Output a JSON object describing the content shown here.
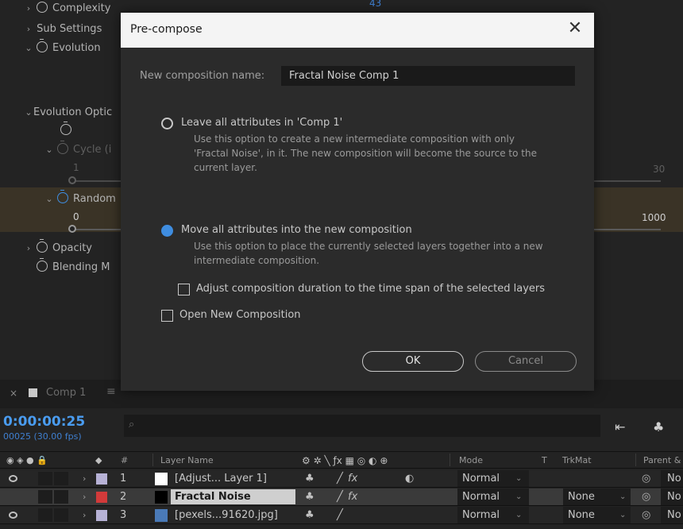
{
  "effect_controls": {
    "top_value": "43",
    "properties": [
      {
        "label": "Complexity",
        "twirl": "›"
      },
      {
        "label": "Sub Settings",
        "twirl": "›"
      },
      {
        "label": "Evolution",
        "twirl": "⌄"
      },
      {
        "label": "Evolution Optic",
        "twirl": "⌄"
      },
      {
        "label": "Cycle (i",
        "twirl": "⌄"
      },
      {
        "label": "Random",
        "twirl": "⌄"
      },
      {
        "label": "Opacity",
        "twirl": "›"
      },
      {
        "label": "Blending M",
        "twirl": ""
      }
    ],
    "cycle_min": "1",
    "cycle_max": "30",
    "random_min": "0",
    "random_max": "1000"
  },
  "dialog": {
    "title": "Pre-compose",
    "close_glyph": "✕",
    "name_label": "New composition name:",
    "name_value": "Fractal Noise Comp 1",
    "option_leave": {
      "label": "Leave all attributes in 'Comp 1'",
      "desc_lines": [
        "Use this option to create a new intermediate composition with only",
        "'Fractal Noise', in it. The new composition will become the source to the",
        "current layer."
      ],
      "selected": false
    },
    "option_move": {
      "label": "Move all attributes into the new composition",
      "desc_lines": [
        "Use this option to place the currently selected layers together into a new",
        "intermediate composition."
      ],
      "selected": true
    },
    "adjust_duration_label": "Adjust composition duration to the time span of the selected layers",
    "open_new_label": "Open New Composition",
    "ok_label": "OK",
    "cancel_label": "Cancel"
  },
  "timeline": {
    "tab_close": "×",
    "tab_name": "Comp 1",
    "tab_menu": "≡",
    "timecode": "0:00:00:25",
    "frame_info": "00025 (30.00 fps)",
    "search_icon": "⌕",
    "header": {
      "hash": "#",
      "layer_name": "Layer Name",
      "mode": "Mode",
      "t": "T",
      "trkmat": "TrkMat",
      "parent": "Parent &"
    },
    "layers": [
      {
        "num": "1",
        "name": "[Adjust... Layer 1]",
        "color": "#b7b2d6",
        "thumb": "#ffffff",
        "mode": "Normal",
        "trkmat": "",
        "parent": "No",
        "selected": false,
        "fx": true,
        "boxed": false
      },
      {
        "num": "2",
        "name": "Fractal Noise",
        "color": "#d23a3a",
        "thumb": "#000000",
        "mode": "Normal",
        "trkmat": "None",
        "parent": "No",
        "selected": true,
        "fx": true,
        "boxed": true
      },
      {
        "num": "3",
        "name": "[pexels...91620.jpg]",
        "color": "#b7b2d6",
        "thumb": "#4a7ab8",
        "mode": "Normal",
        "trkmat": "None",
        "parent": "No",
        "selected": false,
        "fx": false,
        "boxed": false
      }
    ]
  }
}
